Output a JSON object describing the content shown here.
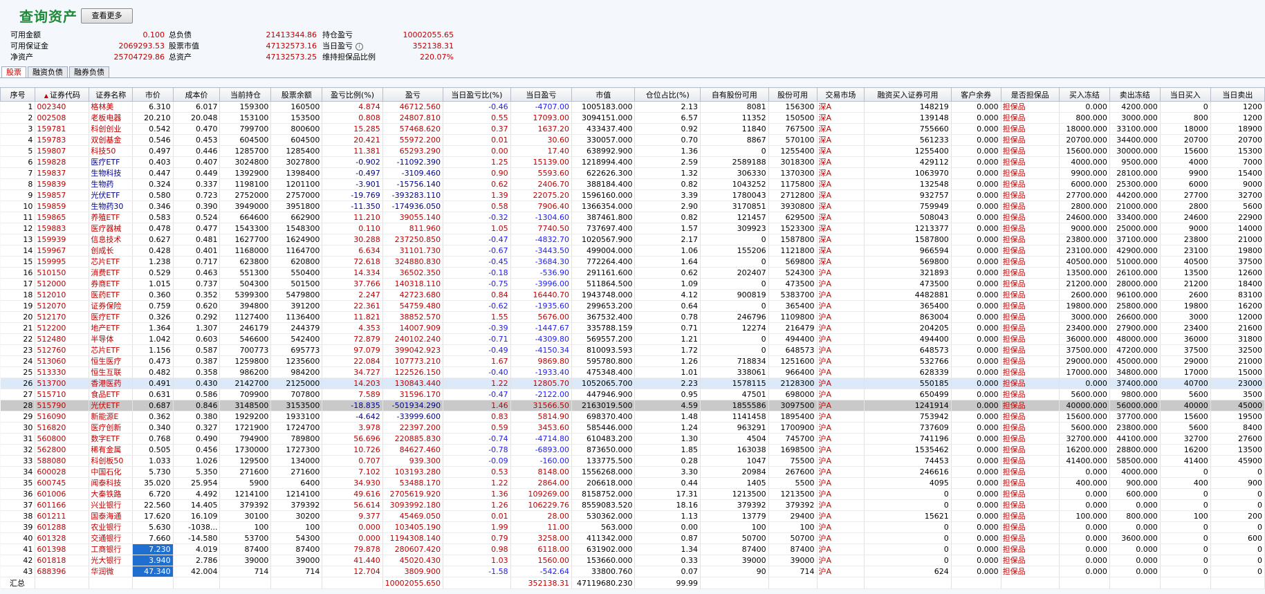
{
  "header": {
    "title": "查询资产",
    "more_label": "查看更多"
  },
  "summary": {
    "rows": [
      {
        "l1": "可用金额",
        "v1": "0.100",
        "l2": "总负债",
        "v2": "21413344.86",
        "l3": "持仓盈亏",
        "v3": "10002055.65",
        "info": ""
      },
      {
        "l1": "可用保证金",
        "v1": "2069293.53",
        "l2": "股票市值",
        "v2": "47132573.16",
        "l3": "当日盈亏",
        "v3": "352138.31",
        "info": "i"
      },
      {
        "l1": "净资产",
        "v1": "25704729.86",
        "l2": "总资产",
        "v2": "47132573.25",
        "l3": "维持担保品比例",
        "v3": "220.07%",
        "info": ""
      }
    ]
  },
  "tabs": [
    {
      "label": "股票",
      "active": true
    },
    {
      "label": "融资负债",
      "active": false
    },
    {
      "label": "融券负债",
      "active": false
    }
  ],
  "columns": [
    "序号",
    "证券代码",
    "证券名称",
    "市价",
    "成本价",
    "当前持仓",
    "股票余额",
    "盈亏比例(%)",
    "盈亏",
    "当日盈亏比(%)",
    "当日盈亏",
    "市值",
    "仓位占比(%)",
    "自有股份可用",
    "股份可用",
    "交易市场",
    "融资买入证券可用",
    "客户余券",
    "是否担保品",
    "买入冻结",
    "卖出冻结",
    "当日买入",
    "当日卖出"
  ],
  "sort_indicator": "▲",
  "rows": [
    [
      "1",
      "002340",
      "格林美",
      "6.310",
      "6.017",
      "159300",
      "160500",
      "4.874",
      "46712.560",
      "-0.46",
      "-4707.00",
      "1005183.000",
      "2.13",
      "8081",
      "156300",
      "深A",
      "148219",
      "0.000",
      "担保品",
      "0.000",
      "4200.000",
      "0",
      "1200"
    ],
    [
      "2",
      "002508",
      "老板电器",
      "20.210",
      "20.048",
      "153100",
      "153500",
      "0.808",
      "24807.810",
      "0.55",
      "17093.00",
      "3094151.000",
      "6.57",
      "11352",
      "150500",
      "深A",
      "139148",
      "0.000",
      "担保品",
      "800.000",
      "3000.000",
      "800",
      "1200"
    ],
    [
      "3",
      "159781",
      "科创创业",
      "0.542",
      "0.470",
      "799700",
      "800600",
      "15.285",
      "57468.620",
      "0.37",
      "1637.20",
      "433437.400",
      "0.92",
      "11840",
      "767500",
      "深A",
      "755660",
      "0.000",
      "担保品",
      "18000.000",
      "33100.000",
      "18000",
      "18900"
    ],
    [
      "4",
      "159783",
      "双创基金",
      "0.546",
      "0.453",
      "604500",
      "604500",
      "20.421",
      "55972.200",
      "0.01",
      "30.60",
      "330057.000",
      "0.70",
      "8867",
      "570100",
      "深A",
      "561233",
      "0.000",
      "担保品",
      "20700.000",
      "34400.000",
      "20700",
      "20700"
    ],
    [
      "5",
      "159807",
      "科技50",
      "0.497",
      "0.446",
      "1285700",
      "1285400",
      "11.381",
      "65293.290",
      "0.00",
      "17.40",
      "638992.900",
      "1.36",
      "0",
      "1255400",
      "深A",
      "1255400",
      "0.000",
      "担保品",
      "15600.000",
      "30000.000",
      "15600",
      "15300"
    ],
    [
      "6",
      "159828",
      "医疗ETF",
      "0.403",
      "0.407",
      "3024800",
      "3027800",
      "-0.902",
      "-11092.390",
      "1.25",
      "15139.00",
      "1218994.400",
      "2.59",
      "2589188",
      "3018300",
      "深A",
      "429112",
      "0.000",
      "担保品",
      "4000.000",
      "9500.000",
      "4000",
      "7000"
    ],
    [
      "7",
      "159837",
      "生物科技",
      "0.447",
      "0.449",
      "1392900",
      "1398400",
      "-0.497",
      "-3109.460",
      "0.90",
      "5593.60",
      "622626.300",
      "1.32",
      "306330",
      "1370300",
      "深A",
      "1063970",
      "0.000",
      "担保品",
      "9900.000",
      "28100.000",
      "9900",
      "15400"
    ],
    [
      "8",
      "159839",
      "生物药",
      "0.324",
      "0.337",
      "1198100",
      "1201100",
      "-3.901",
      "-15756.140",
      "0.62",
      "2406.70",
      "388184.400",
      "0.82",
      "1043252",
      "1175800",
      "深A",
      "132548",
      "0.000",
      "担保品",
      "6000.000",
      "25300.000",
      "6000",
      "9000"
    ],
    [
      "9",
      "159857",
      "光伏ETF",
      "0.580",
      "0.723",
      "2752000",
      "2757000",
      "-19.769",
      "-393283.110",
      "1.39",
      "22075.20",
      "1596160.000",
      "3.39",
      "1780043",
      "2712800",
      "深A",
      "932757",
      "0.000",
      "担保品",
      "27700.000",
      "44200.000",
      "27700",
      "32700"
    ],
    [
      "10",
      "159859",
      "生物药30",
      "0.346",
      "0.390",
      "3949000",
      "3951800",
      "-11.350",
      "-174936.050",
      "0.58",
      "7906.40",
      "1366354.000",
      "2.90",
      "3170851",
      "3930800",
      "深A",
      "759949",
      "0.000",
      "担保品",
      "2800.000",
      "21000.000",
      "2800",
      "5600"
    ],
    [
      "11",
      "159865",
      "养殖ETF",
      "0.583",
      "0.524",
      "664600",
      "662900",
      "11.210",
      "39055.140",
      "-0.32",
      "-1304.60",
      "387461.800",
      "0.82",
      "121457",
      "629500",
      "深A",
      "508043",
      "0.000",
      "担保品",
      "24600.000",
      "33400.000",
      "24600",
      "22900"
    ],
    [
      "12",
      "159883",
      "医疗器械",
      "0.478",
      "0.477",
      "1543300",
      "1548300",
      "0.110",
      "811.960",
      "1.05",
      "7740.50",
      "737697.400",
      "1.57",
      "309923",
      "1523300",
      "深A",
      "1213377",
      "0.000",
      "担保品",
      "9000.000",
      "25000.000",
      "9000",
      "14000"
    ],
    [
      "13",
      "159939",
      "信息技术",
      "0.627",
      "0.481",
      "1627700",
      "1624900",
      "30.288",
      "237250.850",
      "-0.47",
      "-4832.70",
      "1020567.900",
      "2.17",
      "0",
      "1587800",
      "深A",
      "1587800",
      "0.000",
      "担保品",
      "23800.000",
      "37100.000",
      "23800",
      "21000"
    ],
    [
      "14",
      "159967",
      "创成长",
      "0.428",
      "0.401",
      "1168000",
      "1164700",
      "6.634",
      "31101.730",
      "-0.67",
      "-3443.50",
      "499004.000",
      "1.06",
      "155206",
      "1121800",
      "深A",
      "966594",
      "0.000",
      "担保品",
      "23100.000",
      "42900.000",
      "23100",
      "19800"
    ],
    [
      "15",
      "159995",
      "芯片ETF",
      "1.238",
      "0.717",
      "623800",
      "620800",
      "72.618",
      "324880.830",
      "-0.45",
      "-3684.30",
      "772264.400",
      "1.64",
      "0",
      "569800",
      "深A",
      "569800",
      "0.000",
      "担保品",
      "40500.000",
      "51000.000",
      "40500",
      "37500"
    ],
    [
      "16",
      "510150",
      "消费ETF",
      "0.529",
      "0.463",
      "551300",
      "550400",
      "14.334",
      "36502.350",
      "-0.18",
      "-536.90",
      "291161.600",
      "0.62",
      "202407",
      "524300",
      "沪A",
      "321893",
      "0.000",
      "担保品",
      "13500.000",
      "26100.000",
      "13500",
      "12600"
    ],
    [
      "17",
      "512000",
      "券商ETF",
      "1.015",
      "0.737",
      "504300",
      "501500",
      "37.766",
      "140318.110",
      "-0.75",
      "-3996.00",
      "511864.500",
      "1.09",
      "0",
      "473500",
      "沪A",
      "473500",
      "0.000",
      "担保品",
      "21200.000",
      "28000.000",
      "21200",
      "18400"
    ],
    [
      "18",
      "512010",
      "医药ETF",
      "0.360",
      "0.352",
      "5399300",
      "5479800",
      "2.247",
      "42723.680",
      "0.84",
      "16440.70",
      "1943748.000",
      "4.12",
      "900819",
      "5383700",
      "沪A",
      "4482881",
      "0.000",
      "担保品",
      "2600.000",
      "96100.000",
      "2600",
      "83100"
    ],
    [
      "19",
      "512070",
      "证券保险",
      "0.759",
      "0.620",
      "394800",
      "391200",
      "22.361",
      "54759.480",
      "-0.62",
      "-1935.60",
      "299653.200",
      "0.64",
      "0",
      "365400",
      "沪A",
      "365400",
      "0.000",
      "担保品",
      "19800.000",
      "25800.000",
      "19800",
      "16200"
    ],
    [
      "20",
      "512170",
      "医疗ETF",
      "0.326",
      "0.292",
      "1127400",
      "1136400",
      "11.821",
      "38852.570",
      "1.55",
      "5676.00",
      "367532.400",
      "0.78",
      "246796",
      "1109800",
      "沪A",
      "863004",
      "0.000",
      "担保品",
      "3000.000",
      "26600.000",
      "3000",
      "12000"
    ],
    [
      "21",
      "512200",
      "地产ETF",
      "1.364",
      "1.307",
      "246179",
      "244379",
      "4.353",
      "14007.909",
      "-0.39",
      "-1447.67",
      "335788.159",
      "0.71",
      "12274",
      "216479",
      "沪A",
      "204205",
      "0.000",
      "担保品",
      "23400.000",
      "27900.000",
      "23400",
      "21600"
    ],
    [
      "22",
      "512480",
      "半导体",
      "1.042",
      "0.603",
      "546600",
      "542400",
      "72.879",
      "240102.240",
      "-0.71",
      "-4309.80",
      "569557.200",
      "1.21",
      "0",
      "494400",
      "沪A",
      "494400",
      "0.000",
      "担保品",
      "36000.000",
      "48000.000",
      "36000",
      "31800"
    ],
    [
      "23",
      "512760",
      "芯片ETF",
      "1.156",
      "0.587",
      "700773",
      "695773",
      "97.079",
      "399042.923",
      "-0.49",
      "-4150.34",
      "810093.593",
      "1.72",
      "0",
      "648573",
      "沪A",
      "648573",
      "0.000",
      "担保品",
      "37500.000",
      "47200.000",
      "37500",
      "32500"
    ],
    [
      "24",
      "513060",
      "恒生医疗",
      "0.473",
      "0.387",
      "1259800",
      "1235600",
      "22.084",
      "107773.210",
      "1.67",
      "9869.80",
      "595780.800",
      "1.26",
      "718834",
      "1251600",
      "沪A",
      "532766",
      "0.000",
      "担保品",
      "29000.000",
      "45000.000",
      "29000",
      "21000"
    ],
    [
      "25",
      "513330",
      "恒生互联",
      "0.482",
      "0.358",
      "986200",
      "984200",
      "34.727",
      "122526.150",
      "-0.40",
      "-1933.40",
      "475348.400",
      "1.01",
      "338061",
      "966400",
      "沪A",
      "628339",
      "0.000",
      "担保品",
      "17000.000",
      "34800.000",
      "17000",
      "15000"
    ],
    [
      "26",
      "513700",
      "香港医药",
      "0.491",
      "0.430",
      "2142700",
      "2125000",
      "14.203",
      "130843.440",
      "1.22",
      "12805.70",
      "1052065.700",
      "2.23",
      "1578115",
      "2128300",
      "沪A",
      "550185",
      "0.000",
      "担保品",
      "0.000",
      "37400.000",
      "40700",
      "23000"
    ],
    [
      "27",
      "515710",
      "食品ETF",
      "0.631",
      "0.586",
      "709900",
      "707800",
      "7.589",
      "31596.170",
      "-0.47",
      "-2122.00",
      "447946.900",
      "0.95",
      "47501",
      "698000",
      "沪A",
      "650499",
      "0.000",
      "担保品",
      "5600.000",
      "9800.000",
      "5600",
      "3500"
    ],
    [
      "28",
      "515790",
      "光伏ETF",
      "0.687",
      "0.846",
      "3148500",
      "3153500",
      "-18.835",
      "-501934.290",
      "1.46",
      "31566.50",
      "2163019.500",
      "4.59",
      "1855586",
      "3097500",
      "沪A",
      "1241914",
      "0.000",
      "担保品",
      "40000.000",
      "56000.000",
      "40000",
      "45000"
    ],
    [
      "29",
      "516090",
      "新能源E",
      "0.362",
      "0.380",
      "1929200",
      "1933100",
      "-4.642",
      "-33999.600",
      "0.83",
      "5814.90",
      "698370.400",
      "1.48",
      "1141458",
      "1895400",
      "沪A",
      "753942",
      "0.000",
      "担保品",
      "15600.000",
      "37700.000",
      "15600",
      "19500"
    ],
    [
      "30",
      "516820",
      "医疗创新",
      "0.340",
      "0.327",
      "1721900",
      "1724700",
      "3.978",
      "22397.200",
      "0.59",
      "3453.60",
      "585446.000",
      "1.24",
      "963291",
      "1700900",
      "沪A",
      "737609",
      "0.000",
      "担保品",
      "5600.000",
      "23800.000",
      "5600",
      "8400"
    ],
    [
      "31",
      "560800",
      "数字ETF",
      "0.768",
      "0.490",
      "794900",
      "789800",
      "56.696",
      "220885.830",
      "-0.74",
      "-4714.80",
      "610483.200",
      "1.30",
      "4504",
      "745700",
      "沪A",
      "741196",
      "0.000",
      "担保品",
      "32700.000",
      "44100.000",
      "32700",
      "27600"
    ],
    [
      "32",
      "562800",
      "稀有金属",
      "0.505",
      "0.456",
      "1730000",
      "1727300",
      "10.726",
      "84627.460",
      "-0.78",
      "-6893.00",
      "873650.000",
      "1.85",
      "163038",
      "1698500",
      "沪A",
      "1535462",
      "0.000",
      "担保品",
      "16200.000",
      "28800.000",
      "16200",
      "13500"
    ],
    [
      "33",
      "588080",
      "科创板50",
      "1.033",
      "1.026",
      "129500",
      "134000",
      "0.707",
      "939.300",
      "-0.09",
      "-160.00",
      "133775.500",
      "0.28",
      "1047",
      "75500",
      "沪A",
      "74453",
      "0.000",
      "担保品",
      "41400.000",
      "58500.000",
      "41400",
      "45900"
    ],
    [
      "34",
      "600028",
      "中国石化",
      "5.730",
      "5.350",
      "271600",
      "271600",
      "7.102",
      "103193.280",
      "0.53",
      "8148.00",
      "1556268.000",
      "3.30",
      "20984",
      "267600",
      "沪A",
      "246616",
      "0.000",
      "担保品",
      "0.000",
      "4000.000",
      "0",
      "0"
    ],
    [
      "35",
      "600745",
      "闻泰科技",
      "35.020",
      "25.954",
      "5900",
      "6400",
      "34.930",
      "53488.170",
      "1.22",
      "2864.00",
      "206618.000",
      "0.44",
      "1405",
      "5500",
      "沪A",
      "4095",
      "0.000",
      "担保品",
      "400.000",
      "900.000",
      "400",
      "900"
    ],
    [
      "36",
      "601006",
      "大秦铁路",
      "6.720",
      "4.492",
      "1214100",
      "1214100",
      "49.616",
      "2705619.920",
      "1.36",
      "109269.00",
      "8158752.000",
      "17.31",
      "1213500",
      "1213500",
      "沪A",
      "0",
      "0.000",
      "担保品",
      "0.000",
      "600.000",
      "0",
      "0"
    ],
    [
      "37",
      "601166",
      "兴业银行",
      "22.560",
      "14.405",
      "379392",
      "379392",
      "56.614",
      "3093992.180",
      "1.26",
      "106229.76",
      "8559083.520",
      "18.16",
      "379392",
      "379392",
      "沪A",
      "0",
      "0.000",
      "担保品",
      "0.000",
      "0.000",
      "0",
      "0"
    ],
    [
      "38",
      "601211",
      "国泰海通",
      "17.620",
      "16.109",
      "30100",
      "30200",
      "9.377",
      "45469.050",
      "0.01",
      "28.00",
      "530362.000",
      "1.13",
      "13779",
      "29400",
      "沪A",
      "15621",
      "0.000",
      "担保品",
      "100.000",
      "800.000",
      "100",
      "200"
    ],
    [
      "39",
      "601288",
      "农业银行",
      "5.630",
      "-1038...",
      "100",
      "100",
      "0.000",
      "103405.190",
      "1.99",
      "11.00",
      "563.000",
      "0.00",
      "100",
      "100",
      "沪A",
      "0",
      "0.000",
      "担保品",
      "0.000",
      "0.000",
      "0",
      "0"
    ],
    [
      "40",
      "601328",
      "交通银行",
      "7.660",
      "-14.580",
      "53700",
      "54300",
      "0.000",
      "1194308.140",
      "0.79",
      "3258.00",
      "411342.000",
      "0.87",
      "50700",
      "50700",
      "沪A",
      "0",
      "0.000",
      "担保品",
      "0.000",
      "3600.000",
      "0",
      "600"
    ],
    [
      "41",
      "601398",
      "工商银行",
      "7.230",
      "4.019",
      "87400",
      "87400",
      "79.878",
      "280607.420",
      "0.98",
      "6118.00",
      "631902.000",
      "1.34",
      "87400",
      "87400",
      "沪A",
      "0",
      "0.000",
      "担保品",
      "0.000",
      "0.000",
      "0",
      "0"
    ],
    [
      "42",
      "601818",
      "光大银行",
      "3.940",
      "2.786",
      "39000",
      "39000",
      "41.440",
      "45020.430",
      "1.03",
      "1560.00",
      "153660.000",
      "0.33",
      "39000",
      "39000",
      "沪A",
      "0",
      "0.000",
      "担保品",
      "0.000",
      "0.000",
      "0",
      "0"
    ],
    [
      "43",
      "688396",
      "华润微",
      "47.340",
      "42.004",
      "714",
      "714",
      "12.704",
      "3809.900",
      "-1.58",
      "-542.64",
      "33800.760",
      "0.07",
      "90",
      "714",
      "沪A",
      "624",
      "0.000",
      "担保品",
      "0.000",
      "0.000",
      "0",
      "0"
    ]
  ],
  "footer": {
    "label": "汇总",
    "pnl": "10002055.650",
    "day_pnl": "352138.31",
    "market_value": "47119680.230",
    "position_pct": "99.99"
  }
}
